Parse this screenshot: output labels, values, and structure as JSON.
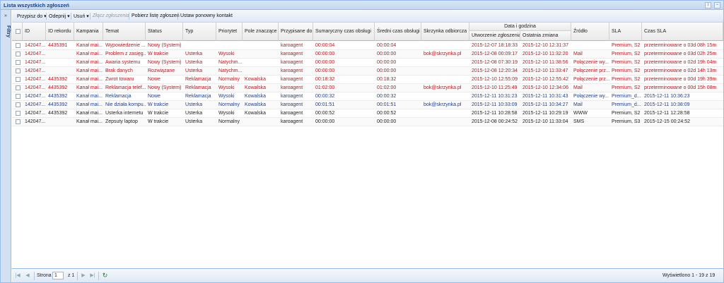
{
  "window": {
    "title": "Lista wszystkich zgłoszeń",
    "icons": [
      "scroll-icon",
      "expand-icon"
    ]
  },
  "sidebar": {
    "label": "Filtry",
    "toggle_icon": "double-chevron-right-icon"
  },
  "toolbar": {
    "assign_label": "Przypisz do",
    "unassign_label": "Odepnij",
    "delete_label": "Usuń",
    "merge_label": "Złącz zgłoszenia",
    "download_label": "Pobierz listę zgłoszeń",
    "recontact_label": "Ustaw ponowny kontakt"
  },
  "columns": {
    "id": "ID",
    "record_id": "ID rekordu",
    "campaign": "Kampania",
    "subject": "Temat",
    "status": "Status",
    "type": "Typ",
    "priority": "Priorytet",
    "marker": "Pole znaczące",
    "assigned": "Przypisane do",
    "total_time": "Sumaryczny czas obsługi",
    "avg_time": "Średni czas obsługi",
    "mailbox": "Skrzynka odbiorcza",
    "date_group": "Data i godzina",
    "created": "Utworzenie zgłoszenia",
    "changed": "Ostatnia zmiana",
    "source": "Źródło",
    "sla": "SLA",
    "sla_time": "Czas SLA"
  },
  "rows": [
    {
      "color": "red",
      "id": "142047...",
      "record": "4435391",
      "campaign": "Kanał mai...",
      "subject": "Wypowiedzenie ...",
      "status": "Nowy (System)",
      "type": "",
      "priority": "",
      "marker": "",
      "assigned": "karoagent",
      "total": "00:00:04",
      "avg": "00:00:04",
      "mailbox": "",
      "created": "2015-12-07 18:18:33",
      "changed": "2015-12-10 12:31:37",
      "source": "",
      "sla": "Premium, S2",
      "sla_time": "przeterminowane o 03d 08h 15m"
    },
    {
      "color": "red",
      "id": "142047...",
      "record": "",
      "campaign": "Kanał mai...",
      "subject": "Problem z zasięg...",
      "status": "W trakcie",
      "type": "Usterka",
      "priority": "Wysoki",
      "marker": "",
      "assigned": "karoagent",
      "total": "00:00:00",
      "avg": "00:00:00",
      "mailbox": "bok@skrzynka.pl",
      "created": "2015-12-08 00:09:17",
      "changed": "2015-12-10 11:32:20",
      "source": "Mail",
      "sla": "Premium, S2",
      "sla_time": "przeterminowane o 03d 02h 25m"
    },
    {
      "color": "red",
      "id": "142047...",
      "record": "",
      "campaign": "Kanał mai...",
      "subject": "Awaria systemu",
      "status": "Nowy (System)",
      "type": "Usterka",
      "priority": "Natychm...",
      "marker": "",
      "assigned": "karoagent",
      "total": "00:00:00",
      "avg": "00:00:00",
      "mailbox": "",
      "created": "2015-12-08 07:30:19",
      "changed": "2015-12-10 11:38:56",
      "source": "Połączenie wy...",
      "sla": "Premium, S2",
      "sla_time": "przeterminowane o 02d 19h 04m"
    },
    {
      "color": "red",
      "id": "142047...",
      "record": "",
      "campaign": "Kanał mai...",
      "subject": "Brak danych",
      "status": "Rozwiązane",
      "type": "Usterka",
      "priority": "Natychm...",
      "marker": "",
      "assigned": "karoagent",
      "total": "00:00:00",
      "avg": "00:00:00",
      "mailbox": "",
      "created": "2015-12-08 12:20:34",
      "changed": "2015-12-10 11:33:47",
      "source": "Połączenie prz...",
      "sla": "Premium, S2",
      "sla_time": "przeterminowane o 02d 14h 13m"
    },
    {
      "color": "red",
      "id": "142047...",
      "record": "4435392",
      "campaign": "Kanał mai...",
      "subject": "Zwrot towaru",
      "status": "Nowe",
      "type": "Reklamacja",
      "priority": "Normalny",
      "marker": "Kowalska",
      "assigned": "karoagent",
      "total": "00:18:32",
      "avg": "00:18:32",
      "mailbox": "",
      "created": "2015-12-10 12:55:09",
      "changed": "2015-12-10 12:55:42",
      "source": "Połączenie prz...",
      "sla": "Premium, S2",
      "sla_time": "przeterminowane o 00d 19h 39m"
    },
    {
      "color": "red",
      "id": "142047...",
      "record": "4435392",
      "campaign": "Kanał mai...",
      "subject": "Reklamacja telef...",
      "status": "Nowy (System)",
      "type": "Reklamacja",
      "priority": "Wysoki",
      "marker": "Kowalska",
      "assigned": "karoagent",
      "total": "01:02:00",
      "avg": "01:02:00",
      "mailbox": "bok@skrzynka.pl",
      "created": "2015-12-10 11:25:49",
      "changed": "2015-12-10 12:34:06",
      "source": "Mail",
      "sla": "Premium, S2",
      "sla_time": "przeterminowane o 00d 15h 08m"
    },
    {
      "color": "blue",
      "id": "142047...",
      "record": "4435392",
      "campaign": "Kanał mai...",
      "subject": "Reklamacja",
      "status": "Nowe",
      "type": "Reklamacja",
      "priority": "Wysoki",
      "marker": "Kowalska",
      "assigned": "karoagent",
      "total": "00:00:32",
      "avg": "00:00:32",
      "mailbox": "",
      "created": "2015-12-11 10:31:23",
      "changed": "2015-12-11 10:31:43",
      "source": "Połączenie wy...",
      "sla": "Premium_d...",
      "sla_time": "2015-12-11 10:36:23"
    },
    {
      "color": "blue",
      "id": "142047...",
      "record": "4435392",
      "campaign": "Kanał mai...",
      "subject": "Nie działa kompu...",
      "status": "W trakcie",
      "type": "Usterka",
      "priority": "Normalny",
      "marker": "Kowalska",
      "assigned": "karoagent",
      "total": "00:01:51",
      "avg": "00:01:51",
      "mailbox": "bok@skrzynka.pl",
      "created": "2015-12-11 10:33:09",
      "changed": "2015-12-11 10:34:27",
      "source": "Mail",
      "sla": "Premium_d...",
      "sla_time": "2015-12-11 10:38:09"
    },
    {
      "color": "blk",
      "id": "142047...",
      "record": "4435392",
      "campaign": "Kanał mai...",
      "subject": "Usterka internetu",
      "status": "W trakcie",
      "type": "Usterka",
      "priority": "Wysoki",
      "marker": "Kowalska",
      "assigned": "karoagent",
      "total": "00:00:52",
      "avg": "00:00:52",
      "mailbox": "",
      "created": "2015-12-11 10:28:58",
      "changed": "2015-12-11 10:29:19",
      "source": "WWW",
      "sla": "Premium, S2",
      "sla_time": "2015-12-11 12:28:58"
    },
    {
      "color": "blk",
      "id": "142047...",
      "record": "",
      "campaign": "Kanał mai...",
      "subject": "Zepsuty laptop",
      "status": "W trakcie",
      "type": "Usterka",
      "priority": "Normalny",
      "marker": "",
      "assigned": "karoagent",
      "total": "00:00:00",
      "avg": "00:00:00",
      "mailbox": "",
      "created": "2015-12-08 00:24:52",
      "changed": "2015-12-10 11:33:04",
      "source": "SMS",
      "sla": "Premium, S3",
      "sla_time": "2015-12-15 00:24:52"
    }
  ],
  "pager": {
    "page_label": "Strona",
    "page_value": "1",
    "of_label": "z 1",
    "summary": "Wyświetlono 1 - 19 z 19"
  }
}
